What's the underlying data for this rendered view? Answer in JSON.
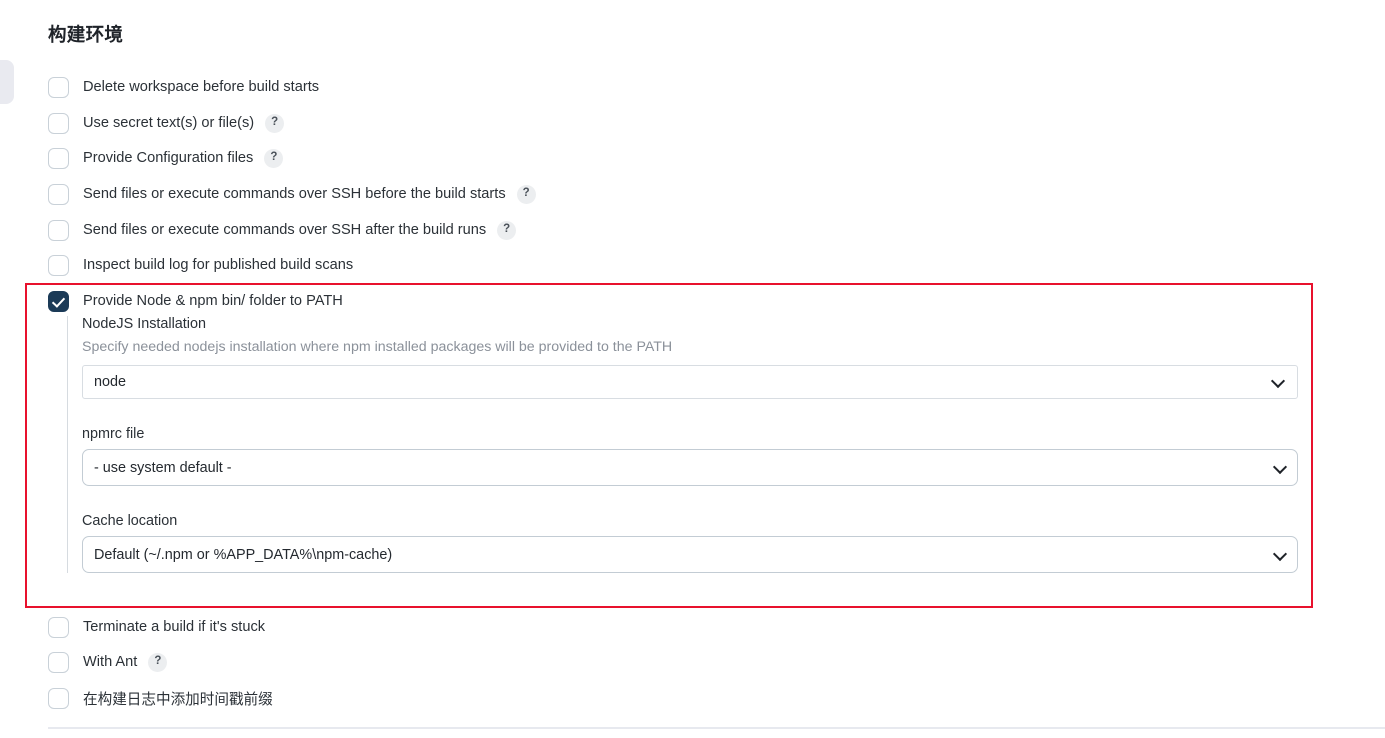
{
  "section": {
    "title": "构建环境"
  },
  "icons": {
    "help": "?",
    "chevron_down": "chevron-down-icon",
    "check": "check-icon"
  },
  "options": [
    {
      "label": "Delete workspace before build starts",
      "checked": false,
      "help": false
    },
    {
      "label": "Use secret text(s) or file(s)",
      "checked": false,
      "help": true
    },
    {
      "label": "Provide Configuration files",
      "checked": false,
      "help": true
    },
    {
      "label": "Send files or execute commands over SSH before the build starts",
      "checked": false,
      "help": true
    },
    {
      "label": "Send files or execute commands over SSH after the build runs",
      "checked": false,
      "help": true
    },
    {
      "label": "Inspect build log for published build scans",
      "checked": false,
      "help": false
    },
    {
      "label": "Provide Node & npm bin/ folder to PATH",
      "checked": true,
      "help": false
    }
  ],
  "nodejs": {
    "installation": {
      "label": "NodeJS Installation",
      "description": "Specify needed nodejs installation where npm installed packages will be provided to the PATH",
      "value": "node"
    },
    "npmrc": {
      "label": "npmrc file",
      "value": "- use system default -"
    },
    "cache": {
      "label": "Cache location",
      "value": "Default (~/.npm or %APP_DATA%\\npm-cache)"
    }
  },
  "trailing_options": [
    {
      "label": "Terminate a build if it's stuck",
      "checked": false,
      "help": false
    },
    {
      "label": "With Ant",
      "checked": false,
      "help": true
    },
    {
      "label": "在构建日志中添加时间戳前缀",
      "checked": false,
      "help": false
    }
  ],
  "colors": {
    "highlight_border": "#e8112d",
    "checkbox_checked": "#1b3a57",
    "text_primary": "#2b3137",
    "text_muted": "#8b919a"
  }
}
